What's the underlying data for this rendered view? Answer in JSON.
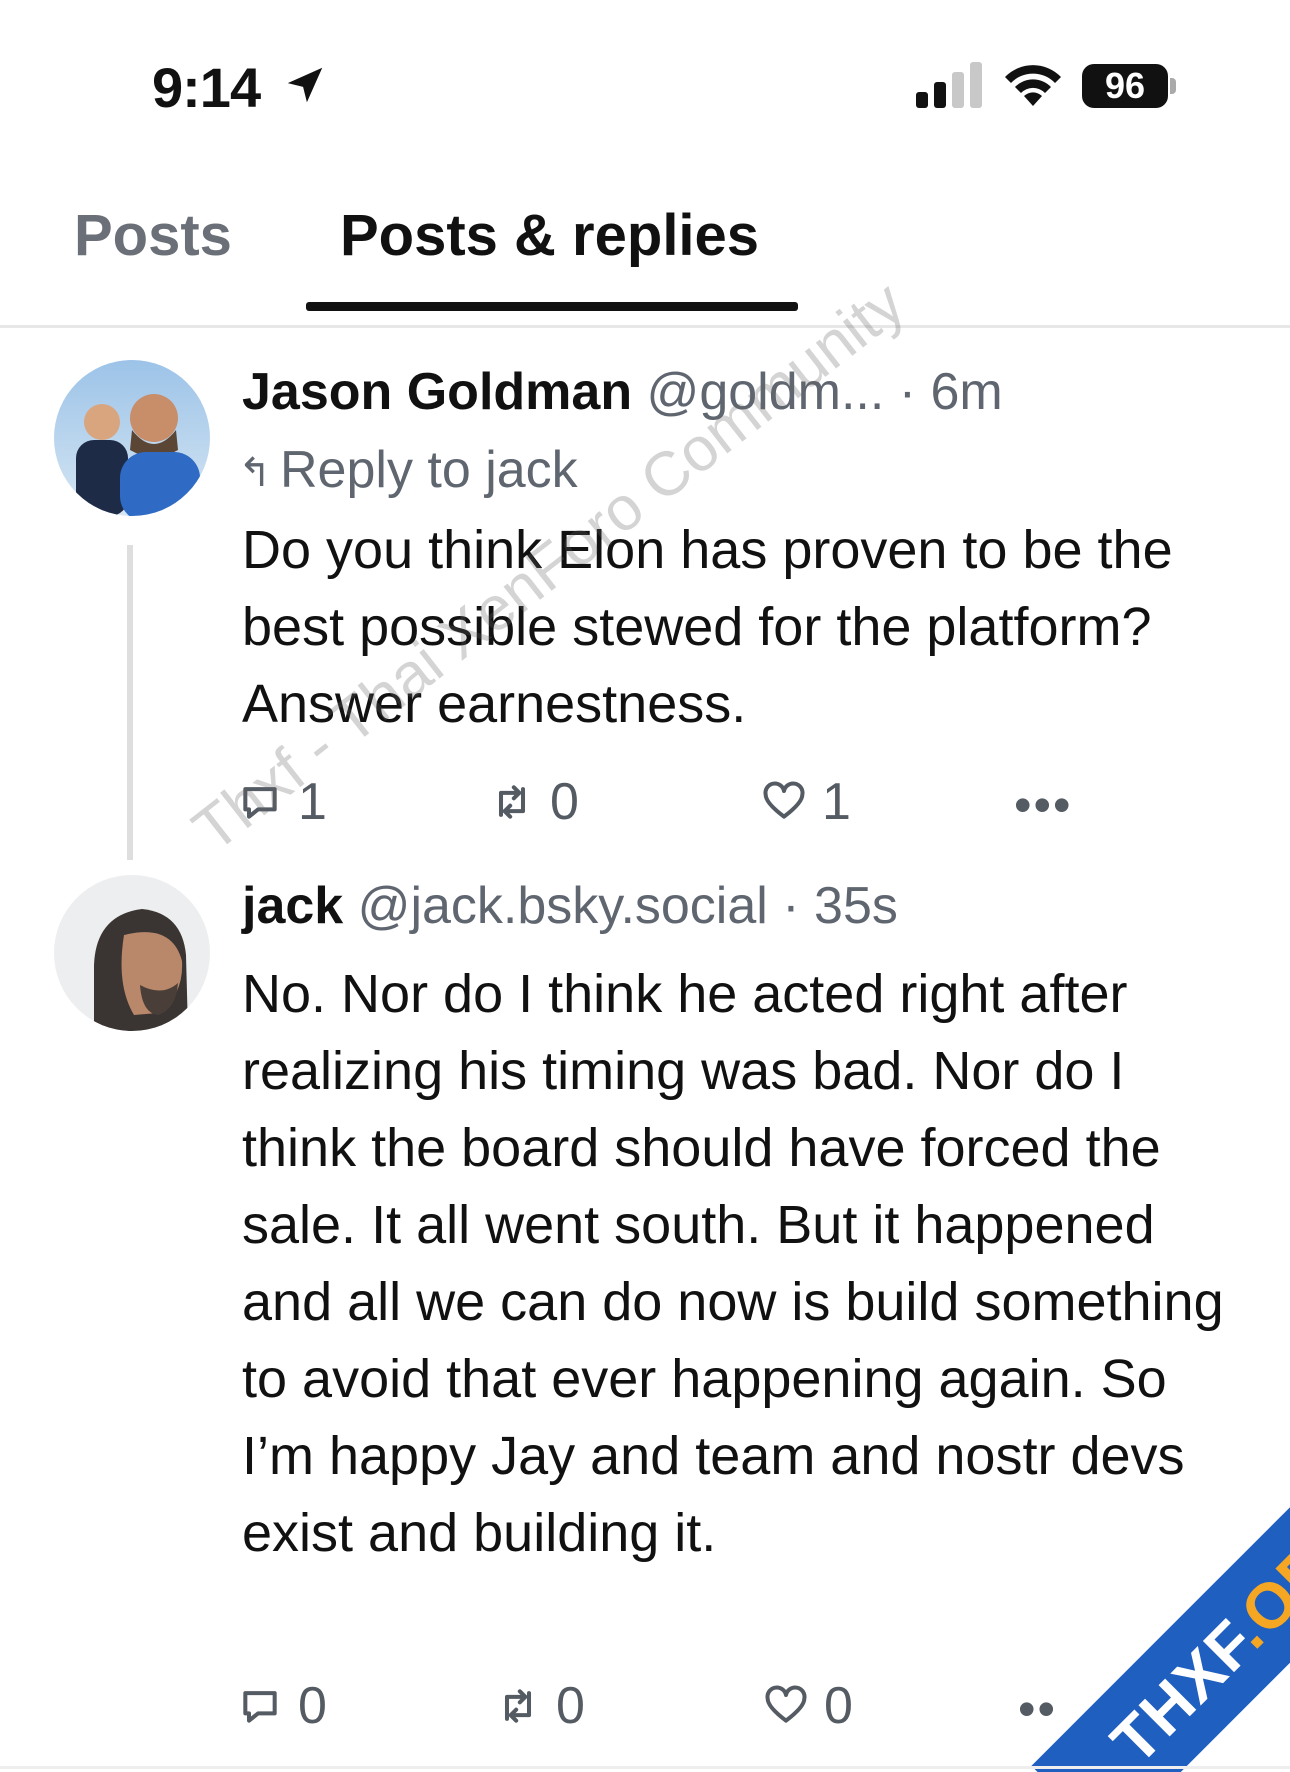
{
  "status_bar": {
    "time": "9:14",
    "battery": "96"
  },
  "tabs": [
    {
      "label": "Posts",
      "active": false
    },
    {
      "label": "Posts & replies",
      "active": true
    }
  ],
  "posts": [
    {
      "name": "Jason Goldman",
      "handle": "@goldm...",
      "time": "· 6m",
      "reply_to": "Reply to jack",
      "text": "Do you think Elon has proven to be the best possible stewed for the platform? Answer earnestness.",
      "replies": "1",
      "reposts": "0",
      "likes": "1"
    },
    {
      "name": "jack",
      "handle": "@jack.bsky.social",
      "time": "· 35s",
      "text": "No. Nor do I think he acted right after realizing his timing was bad. Nor do I think the board should have forced the sale. It all went south. But it happened and all we can do now is build something to avoid that ever happening again. So I’m happy Jay and team and nostr devs exist and building it.",
      "replies": "0",
      "reposts": "0",
      "likes": "0"
    }
  ],
  "watermark": "Thxf - Thai XenForo Community",
  "badge": {
    "main": "THXF",
    "accent": ".ORG"
  },
  "colors": {
    "text": "#111111",
    "muted": "#5f6670",
    "badge_blue": "#1f5fbf",
    "badge_orange": "#f5a623"
  }
}
